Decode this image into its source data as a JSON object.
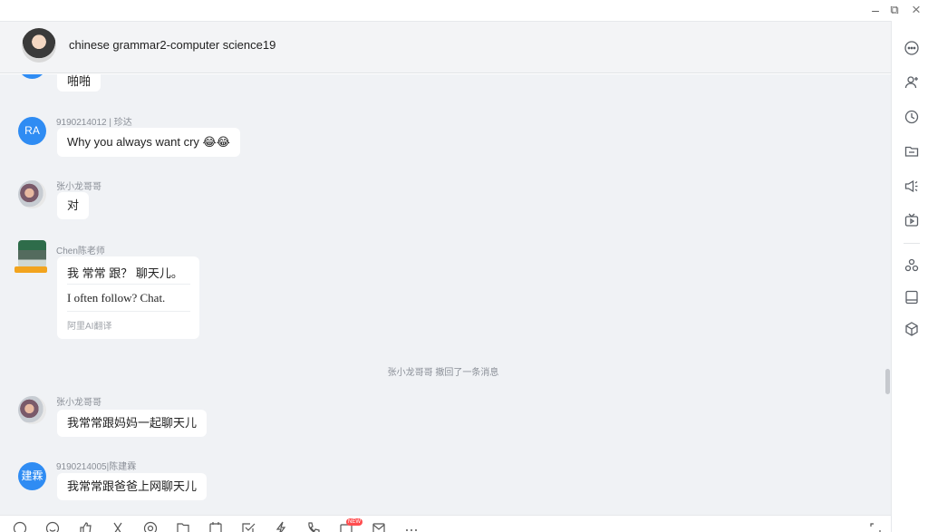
{
  "window": {
    "controls": [
      {
        "name": "minimize",
        "glyph": "–"
      },
      {
        "name": "restore",
        "glyph": "⧉"
      },
      {
        "name": "close",
        "glyph": "×"
      }
    ]
  },
  "header": {
    "chat_title": "chinese grammar2-computer science19"
  },
  "messages": [
    {
      "id": "m0",
      "sender": "",
      "text": "啪啪"
    },
    {
      "id": "m1",
      "sender": "9190214012 | 珍达",
      "avatar_text": "RA",
      "text": "Why you always want cry 😂😂"
    },
    {
      "id": "m2",
      "sender": "张小龙哥哥",
      "text": "对"
    },
    {
      "id": "m3",
      "sender": "Chen陈老师",
      "original": "我 常常 跟？ 聊天儿。",
      "translation": "I often follow? Chat.",
      "translation_source": "阿里AI翻译"
    },
    {
      "id": "m4",
      "sender": "张小龙哥哥",
      "text": "我常常跟妈妈一起聊天儿"
    },
    {
      "id": "m5",
      "sender": "9190214005|陈建霖",
      "avatar_text": "建霖",
      "text": "我常常跟爸爸上网聊天儿"
    }
  ],
  "system_notice": "张小龙哥哥 撤回了一条消息",
  "sidebar_icons": [
    "more-icon",
    "add-member-icon",
    "history-icon",
    "folder-icon",
    "announcement-icon",
    "live-icon",
    "apps-icon",
    "notes-icon",
    "add-app-icon"
  ],
  "toolbar_icons": [
    "gif-icon",
    "emoji-icon",
    "like-icon",
    "scissors-icon",
    "mention-icon",
    "file-icon",
    "calendar-icon",
    "todo-icon",
    "flash-icon",
    "call-icon",
    "video-icon",
    "mail-icon",
    "more-icon"
  ],
  "toolbar_new_badge": "NEW",
  "colors": {
    "accent": "#2f8cf3",
    "chat_bg": "#f0f2f5",
    "header_bg": "#f3f4f6",
    "badge_red": "#ff4d4f"
  }
}
